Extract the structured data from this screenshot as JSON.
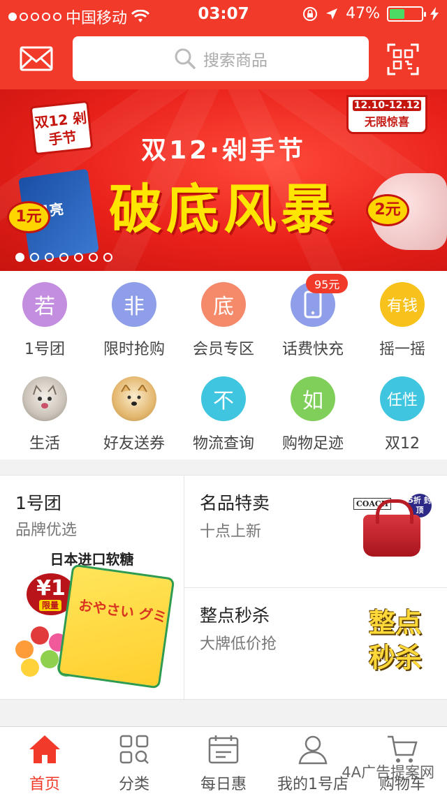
{
  "status_bar": {
    "carrier": "中国移动",
    "time": "03:07",
    "battery": "47%"
  },
  "header": {
    "search_placeholder": "搜索商品"
  },
  "banner": {
    "corner_badge": "双12 剁手节",
    "date_range": "12.10-12.12",
    "date_tag": "无限惊喜",
    "subtitle": "双12·剁手节",
    "title": "破底风暴",
    "price_left": "1元",
    "price_right": "2元",
    "product_brand": "月亮",
    "slide_count": 7,
    "active_slide": 1
  },
  "icon_grid": [
    {
      "label": "1号团",
      "glyph": "若",
      "color": "#c48ee0"
    },
    {
      "label": "限时抢购",
      "glyph": "非",
      "color": "#8e9ee8"
    },
    {
      "label": "会员专区",
      "glyph": "底",
      "color": "#f58a6a"
    },
    {
      "label": "话费快充",
      "icon": "phone-icon",
      "color": "#8e9ee8",
      "badge": "95元"
    },
    {
      "label": "摇一摇",
      "glyph": "有钱",
      "color": "#f7c21c"
    },
    {
      "label": "生活",
      "icon": "cat-photo-icon",
      "color": "#d8d8d8"
    },
    {
      "label": "好友送券",
      "icon": "dog-photo-icon",
      "color": "#f0d9a8"
    },
    {
      "label": "物流查询",
      "glyph": "不",
      "color": "#3fc5df"
    },
    {
      "label": "购物足迹",
      "glyph": "如",
      "color": "#7fcf5a"
    },
    {
      "label": "双12",
      "glyph": "任性",
      "color": "#3fc5df"
    }
  ],
  "promo": {
    "group": {
      "title": "1号团",
      "subtitle": "品牌优选",
      "caption": "日本进口软糖",
      "price": "¥1",
      "price_tag": "限量",
      "pack_text": "おやさい グミ"
    },
    "brand_sale": {
      "title": "名品特卖",
      "subtitle": "十点上新",
      "brand": "COACH",
      "discount": "5折 封顶"
    },
    "flash_sale": {
      "title": "整点秒杀",
      "subtitle": "大牌低价抢",
      "logo": "整点 秒杀"
    }
  },
  "tabs": [
    {
      "label": "首页",
      "icon": "home-icon",
      "active": true
    },
    {
      "label": "分类",
      "icon": "grid-search-icon",
      "active": false
    },
    {
      "label": "每日惠",
      "icon": "calendar-icon",
      "active": false
    },
    {
      "label": "我的1号店",
      "icon": "user-icon",
      "active": false
    },
    {
      "label": "购物车",
      "icon": "cart-icon",
      "active": false
    }
  ],
  "watermark": "4A广告提案网",
  "colors": {
    "brand_red": "#f23a2a",
    "banner_yellow": "#ffe600"
  }
}
